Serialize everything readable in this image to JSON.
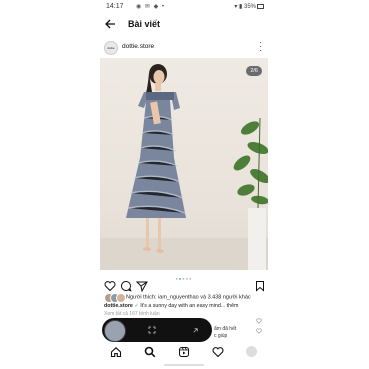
{
  "status": {
    "time": "14:17",
    "battery": "35%"
  },
  "header": {
    "title": "Bài viết"
  },
  "account": {
    "name": "dottie.store",
    "avatar_text": "dottie"
  },
  "post": {
    "image_counter": "2/6",
    "likes_text": "Người thích: iam_nguyenthao và 3.438 người khác",
    "caption_user": "dottie.store",
    "caption_text": "It's a sunny day with an easy mind... thêm",
    "comments_link": "Xem tất cả 167 bình luận"
  },
  "overlay": {
    "behind_text_1": "ẩm đã hết",
    "behind_text_2": "c giúp"
  },
  "colors": {
    "accent": "#3897f0",
    "counter_bg": "#6b6b6b"
  }
}
